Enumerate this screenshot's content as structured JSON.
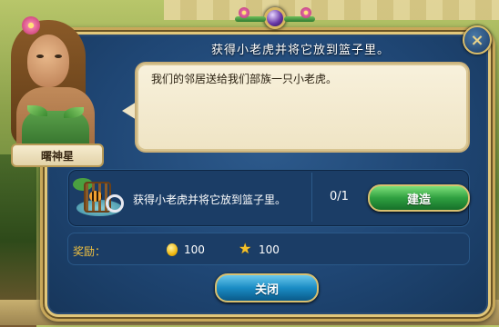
{
  "dialog": {
    "title": "获得小老虎并将它放到篮子里。",
    "close_icon": "×",
    "close_label": "关闭"
  },
  "character": {
    "name": "曙神星",
    "speech": "我们的邻居送给我们部族一只小老虎。"
  },
  "task": {
    "icon": "tiger-cage-icon",
    "description": "获得小老虎并将它放到篮子里。",
    "progress": "0/1",
    "action_label": "建造"
  },
  "rewards": {
    "label": "奖励：",
    "items": [
      {
        "icon": "coin-icon",
        "value": "100"
      },
      {
        "icon": "star-icon",
        "value": "100"
      }
    ]
  },
  "colors": {
    "panel": "#1f4674",
    "accent_gold": "#c8a85a",
    "build_button": "#2fa040",
    "close_button": "#1a8cc4",
    "reward_label": "#f0c040"
  }
}
